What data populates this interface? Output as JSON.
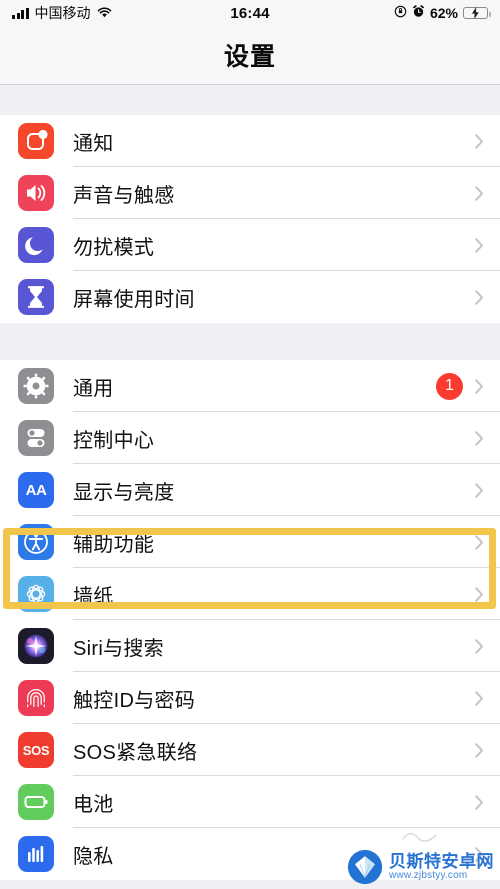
{
  "status_bar": {
    "carrier": "中国移动",
    "time": "16:44",
    "battery_percent": "62%",
    "icons": [
      "signal-bars-icon",
      "wifi-icon",
      "rotation-lock-icon",
      "alarm-clock-icon",
      "battery-charging-icon"
    ]
  },
  "navbar": {
    "title": "设置"
  },
  "groups": [
    {
      "id": "group-notifications",
      "rows": [
        {
          "label": "通知",
          "icon": "notifications-icon",
          "color": "#F5472A",
          "badge": "",
          "chevron": "chevron-right-icon"
        },
        {
          "label": "声音与触感",
          "icon": "sounds-haptics-icon",
          "color": "#EE4359",
          "badge": "",
          "chevron": "chevron-right-icon"
        },
        {
          "label": "勿扰模式",
          "icon": "do-not-disturb-icon",
          "color": "#5956D5",
          "badge": "",
          "chevron": "chevron-right-icon"
        },
        {
          "label": "屏幕使用时间",
          "icon": "screen-time-icon",
          "color": "#5956D5",
          "badge": "",
          "chevron": "chevron-right-icon"
        }
      ]
    },
    {
      "id": "group-general",
      "rows": [
        {
          "label": "通用",
          "icon": "gear-icon",
          "color": "#8E8E93",
          "badge": "1",
          "chevron": "chevron-right-icon"
        },
        {
          "label": "控制中心",
          "icon": "control-center-icon",
          "color": "#8E8E93",
          "badge": "",
          "chevron": "chevron-right-icon"
        },
        {
          "label": "显示与亮度",
          "icon": "display-brightness-icon",
          "color": "#2C6BED",
          "badge": "",
          "chevron": "chevron-right-icon"
        },
        {
          "label": "辅助功能",
          "icon": "accessibility-icon",
          "color": "#2D79E8",
          "badge": "",
          "chevron": "chevron-right-icon"
        },
        {
          "label": "墙纸",
          "icon": "wallpaper-icon",
          "color": "#57B0E8",
          "badge": "",
          "chevron": "chevron-right-icon"
        },
        {
          "label": "Siri与搜索",
          "icon": "siri-icon",
          "color": "#1B1B2B",
          "badge": "",
          "chevron": "chevron-right-icon"
        },
        {
          "label": "触控ID与密码",
          "icon": "touch-id-icon",
          "color": "#EE3B55",
          "badge": "",
          "chevron": "chevron-right-icon"
        },
        {
          "label": "SOS紧急联络",
          "icon": "sos-icon",
          "color": "#F03C2E",
          "badge": "",
          "chevron": "chevron-right-icon"
        },
        {
          "label": "电池",
          "icon": "battery-icon",
          "color": "#61CB5C",
          "badge": "",
          "chevron": "chevron-right-icon"
        },
        {
          "label": "隐私",
          "icon": "privacy-icon",
          "color": "#2C6BED",
          "badge": "",
          "chevron": "chevron-right-icon"
        }
      ]
    }
  ],
  "highlight": {
    "target_label": "辅助功能",
    "color": "#F2C64B"
  },
  "watermark": {
    "name": "贝斯特安卓网",
    "url": "www.zjbstyy.com",
    "color": "#1F6FD0"
  }
}
